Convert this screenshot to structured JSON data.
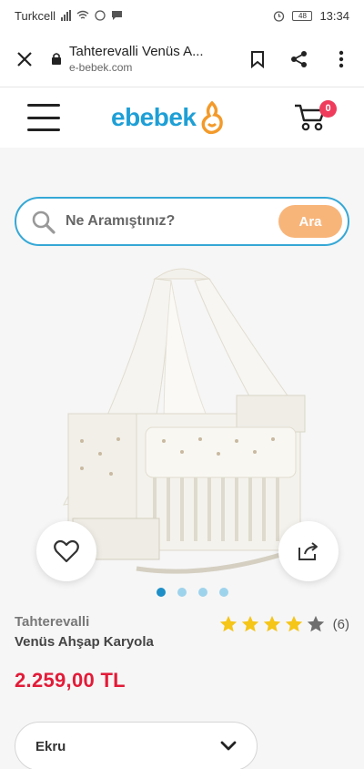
{
  "status_bar": {
    "carrier": "Turkcell",
    "battery": "48",
    "time": "13:34"
  },
  "browser": {
    "page_title": "Tahterevalli Venüs A...",
    "domain": "e-bebek.com"
  },
  "site": {
    "logo_text": "ebebek",
    "cart_count": "0",
    "brand_color": "#1e9fd6",
    "accent_color": "#f8b57a"
  },
  "search": {
    "placeholder": "Ne Aramıştınız?",
    "button_label": "Ara"
  },
  "gallery": {
    "slide_count": 4,
    "active_slide": 1
  },
  "product": {
    "brand": "Tahterevalli",
    "name": "Venüs Ahşap Karyola",
    "rating": 4,
    "rating_max": 5,
    "review_count": "(6)",
    "price": "2.259,00 TL",
    "price_color": "#e31b38"
  },
  "variant": {
    "selected": "Ekru"
  }
}
